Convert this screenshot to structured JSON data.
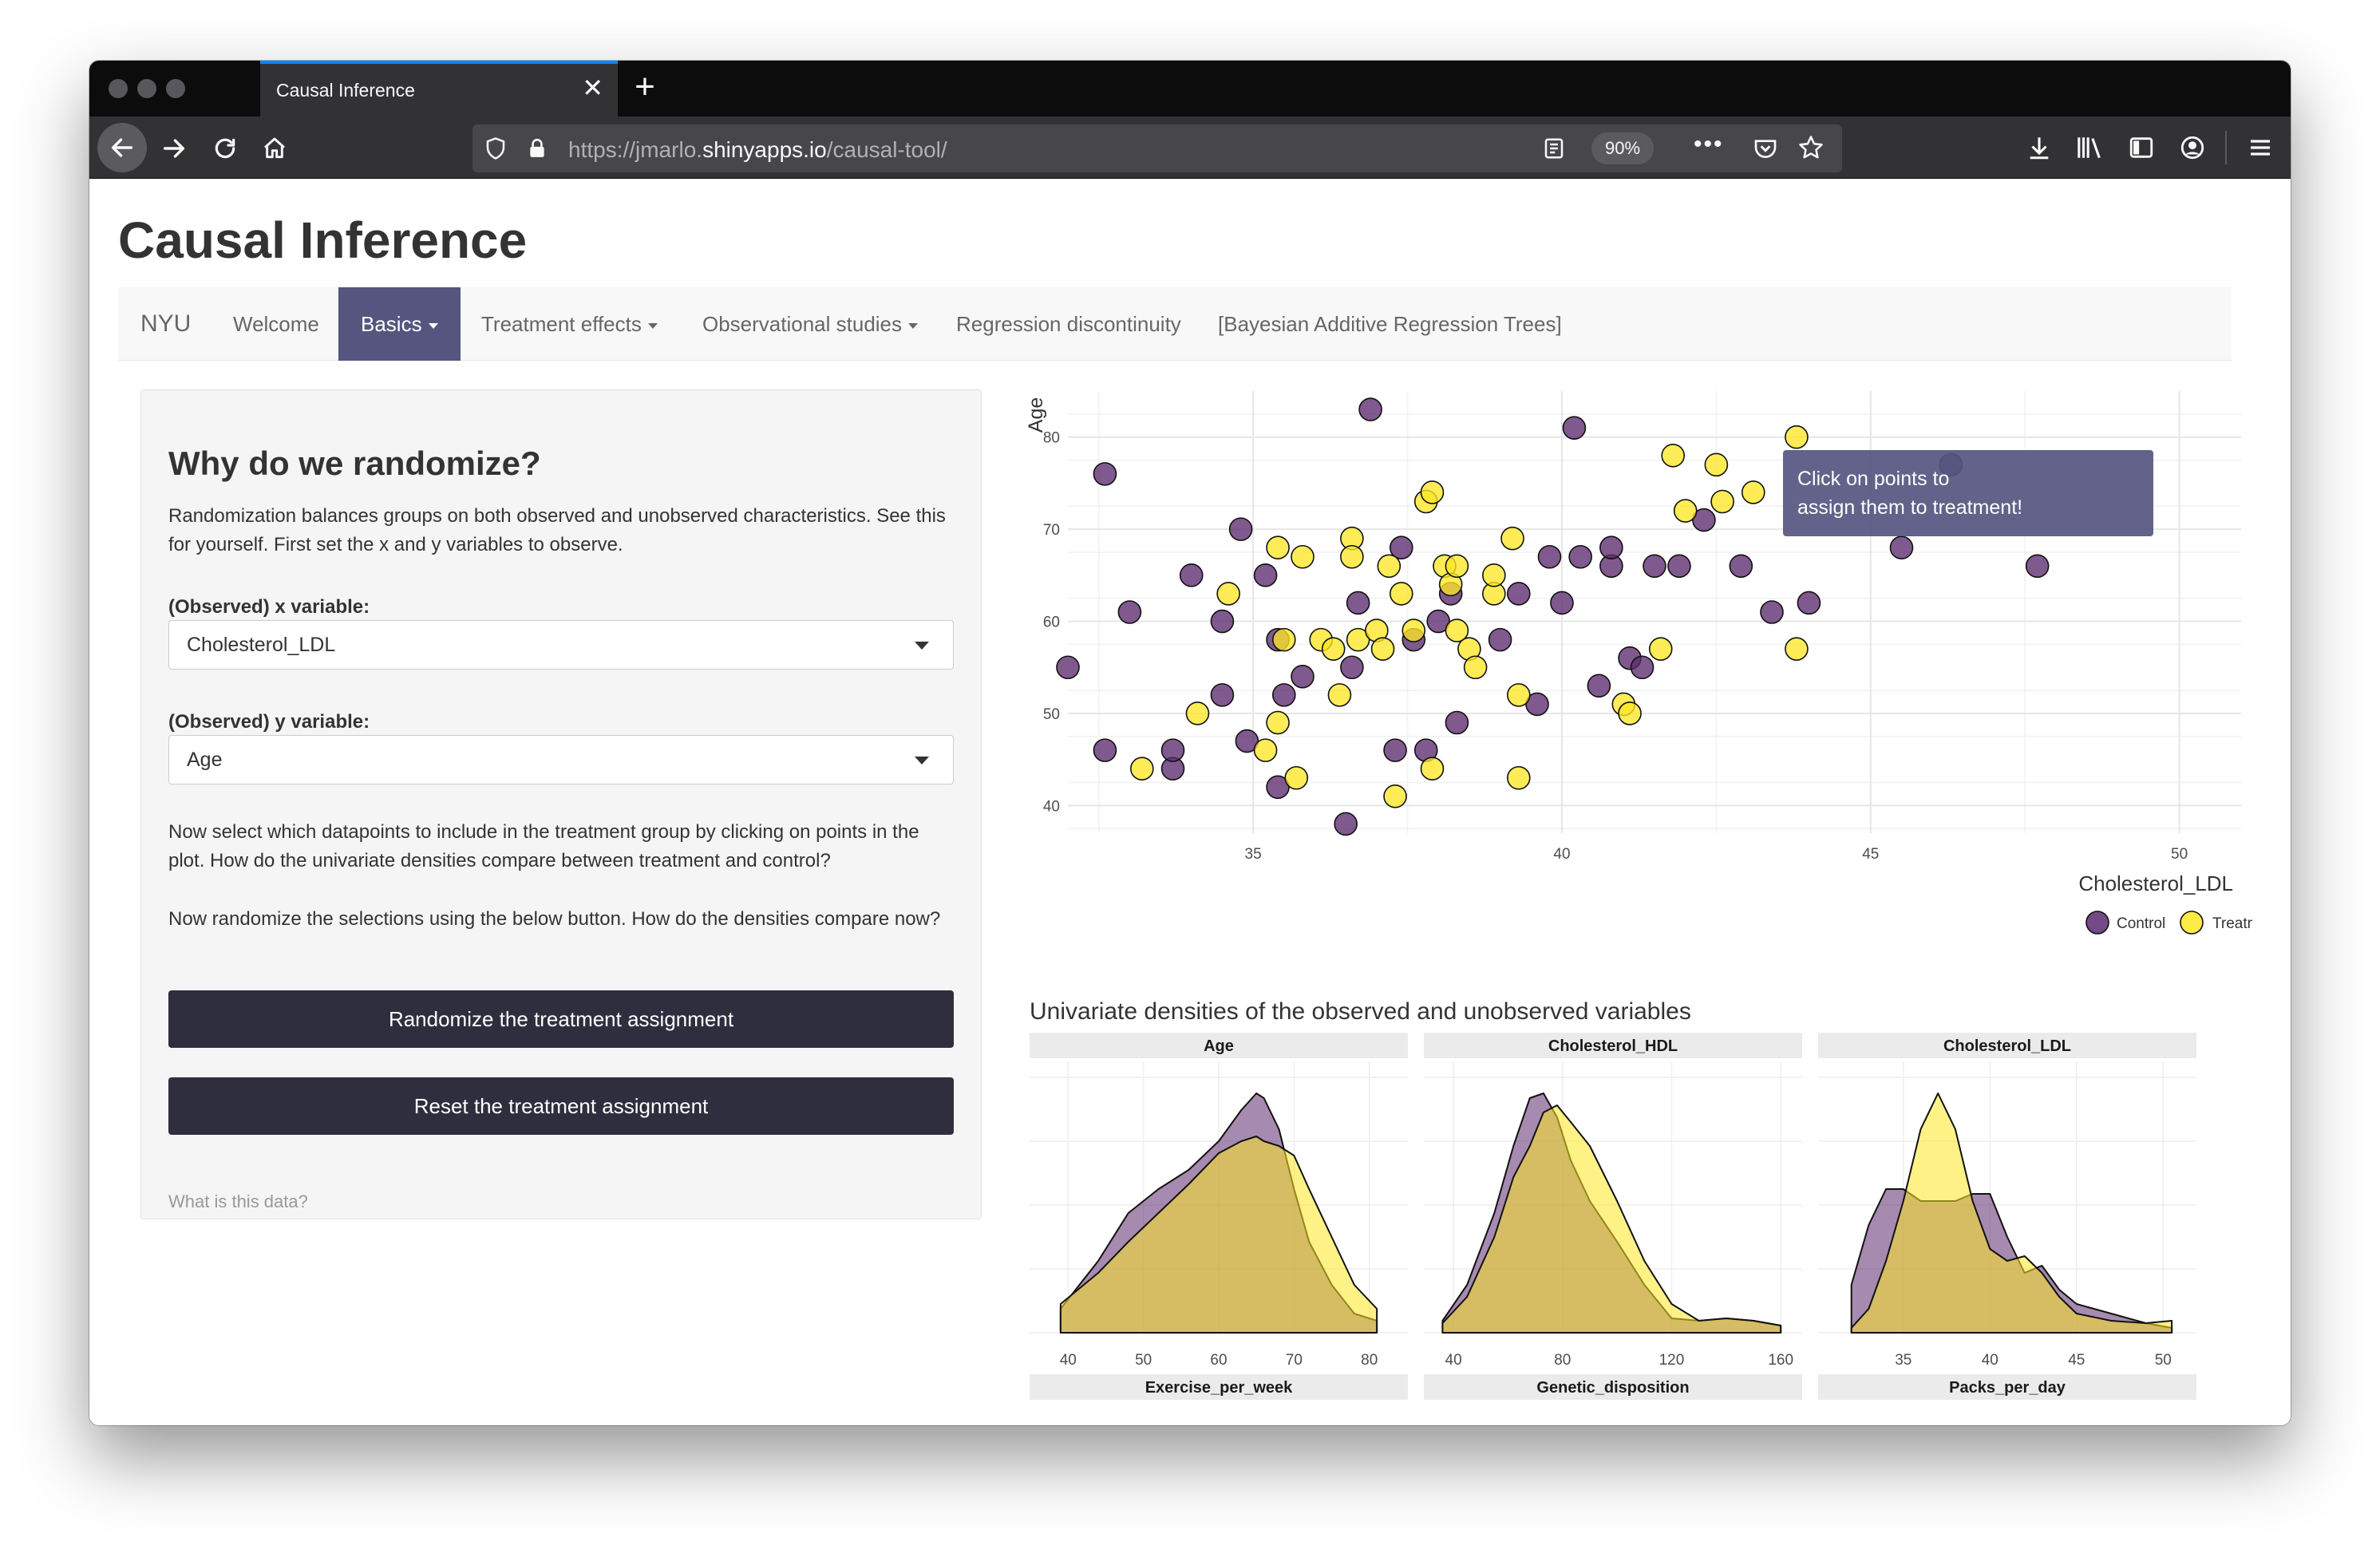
{
  "browser": {
    "tab_title": "Causal Inference",
    "url_host": "https://jmarlo.",
    "url_domain": "shinyapps.io",
    "url_path": "/causal-tool/",
    "zoom": "90%"
  },
  "app": {
    "title": "Causal Inference",
    "menu": [
      "NYU",
      "Welcome",
      "Basics",
      "Treatment effects",
      "Observational studies",
      "Regression discontinuity",
      "[Bayesian Additive Regression Trees]"
    ]
  },
  "sidebar": {
    "title": "Why do we randomize?",
    "intro": "Randomization balances groups on both observed and unobserved characteristics. See this for yourself. First set the x and y variables to observe.",
    "x_label": "(Observed) x variable:",
    "x_value": "Cholesterol_LDL",
    "y_label": "(Observed) y variable:",
    "y_value": "Age",
    "p1": "Now select which datapoints to include in the treatment group by clicking on points in the plot. How do the univariate densities compare between treatment and control?",
    "p2": "Now randomize the selections using the below button. How do the densities compare now?",
    "btn_randomize": "Randomize the treatment assignment",
    "btn_reset": "Reset the treatment assignment",
    "link": "What is this data?"
  },
  "tooltip": "Click on points to assign them to treatment!",
  "density_title": "Univariate densities of the observed and unobserved variables",
  "colors": {
    "control": "#5c2a6e",
    "treatment": "#fde725",
    "overlap": "#c8a951"
  },
  "chart_data": [
    {
      "type": "scatter",
      "xlabel": "Cholesterol_LDL",
      "ylabel": "Age",
      "xlim": [
        32,
        51
      ],
      "ylim": [
        37,
        85
      ],
      "xticks": [
        35,
        40,
        45,
        50
      ],
      "yticks": [
        40,
        50,
        60,
        70,
        80
      ],
      "legend": [
        "Control",
        "Treatment"
      ],
      "series": [
        {
          "name": "Control",
          "points": [
            [
              32.0,
              55
            ],
            [
              32.6,
              46
            ],
            [
              32.6,
              76
            ],
            [
              33.0,
              61
            ],
            [
              33.7,
              44
            ],
            [
              33.7,
              46
            ],
            [
              34.0,
              65
            ],
            [
              34.5,
              60
            ],
            [
              34.5,
              52
            ],
            [
              34.8,
              70
            ],
            [
              34.9,
              47
            ],
            [
              35.2,
              65
            ],
            [
              35.4,
              58
            ],
            [
              35.4,
              42
            ],
            [
              35.5,
              52
            ],
            [
              35.8,
              54
            ],
            [
              36.5,
              38
            ],
            [
              36.6,
              55
            ],
            [
              36.7,
              62
            ],
            [
              36.9,
              83
            ],
            [
              37.3,
              46
            ],
            [
              37.4,
              68
            ],
            [
              37.6,
              58
            ],
            [
              37.8,
              46
            ],
            [
              38.0,
              60
            ],
            [
              38.2,
              63
            ],
            [
              38.3,
              49
            ],
            [
              39.0,
              58
            ],
            [
              39.3,
              63
            ],
            [
              39.6,
              51
            ],
            [
              39.8,
              67
            ],
            [
              40.2,
              81
            ],
            [
              40.0,
              62
            ],
            [
              40.3,
              67
            ],
            [
              40.6,
              53
            ],
            [
              40.8,
              66
            ],
            [
              40.8,
              68
            ],
            [
              41.1,
              56
            ],
            [
              41.3,
              55
            ],
            [
              41.5,
              66
            ],
            [
              41.9,
              66
            ],
            [
              42.3,
              71
            ],
            [
              42.9,
              66
            ],
            [
              43.4,
              61
            ],
            [
              44.0,
              62
            ],
            [
              45.5,
              68
            ],
            [
              46.3,
              77
            ],
            [
              47.7,
              66
            ]
          ]
        },
        {
          "name": "Treatment",
          "points": [
            [
              33.2,
              44
            ],
            [
              34.1,
              50
            ],
            [
              34.6,
              63
            ],
            [
              35.2,
              46
            ],
            [
              35.4,
              68
            ],
            [
              35.4,
              49
            ],
            [
              35.5,
              58
            ],
            [
              35.7,
              43
            ],
            [
              35.8,
              67
            ],
            [
              36.1,
              58
            ],
            [
              36.3,
              57
            ],
            [
              36.4,
              52
            ],
            [
              36.6,
              69
            ],
            [
              36.6,
              67
            ],
            [
              36.7,
              58
            ],
            [
              37.0,
              59
            ],
            [
              37.1,
              57
            ],
            [
              37.2,
              66
            ],
            [
              37.4,
              63
            ],
            [
              37.3,
              41
            ],
            [
              37.6,
              59
            ],
            [
              37.8,
              73
            ],
            [
              37.9,
              74
            ],
            [
              37.9,
              44
            ],
            [
              38.1,
              66
            ],
            [
              38.2,
              64
            ],
            [
              38.3,
              59
            ],
            [
              38.3,
              66
            ],
            [
              38.5,
              57
            ],
            [
              38.6,
              55
            ],
            [
              38.9,
              63
            ],
            [
              38.9,
              65
            ],
            [
              39.2,
              69
            ],
            [
              39.3,
              52
            ],
            [
              39.3,
              43
            ],
            [
              41.0,
              51
            ],
            [
              41.1,
              50
            ],
            [
              41.6,
              57
            ],
            [
              41.8,
              78
            ],
            [
              42.0,
              72
            ],
            [
              42.5,
              77
            ],
            [
              42.6,
              73
            ],
            [
              43.1,
              74
            ],
            [
              43.8,
              80
            ],
            [
              43.8,
              57
            ]
          ]
        }
      ]
    },
    {
      "type": "area",
      "title": "Age",
      "xticks": [
        40,
        50,
        60,
        70,
        80
      ],
      "xlim": [
        37,
        83
      ],
      "series": [
        {
          "name": "Control",
          "x": [
            39,
            44,
            48,
            52,
            56,
            60,
            63,
            65,
            66,
            68,
            70,
            72,
            75,
            78,
            81
          ],
          "y": [
            0.1,
            0.3,
            0.5,
            0.6,
            0.68,
            0.8,
            0.93,
            1.0,
            0.98,
            0.85,
            0.6,
            0.38,
            0.2,
            0.08,
            0.05
          ]
        },
        {
          "name": "Treatment",
          "x": [
            39,
            44,
            48,
            52,
            56,
            60,
            63,
            65,
            66,
            68,
            70,
            72,
            75,
            78,
            81
          ],
          "y": [
            0.12,
            0.25,
            0.38,
            0.5,
            0.62,
            0.75,
            0.8,
            0.82,
            0.8,
            0.78,
            0.74,
            0.6,
            0.4,
            0.2,
            0.1
          ]
        }
      ]
    },
    {
      "type": "area",
      "title": "Cholesterol_HDL",
      "xticks": [
        40,
        80,
        120,
        160
      ],
      "xlim": [
        35,
        162
      ],
      "series": [
        {
          "name": "Control",
          "x": [
            36,
            45,
            55,
            62,
            68,
            73,
            78,
            83,
            90,
            100,
            110,
            120,
            130,
            140,
            150,
            160
          ],
          "y": [
            0.05,
            0.2,
            0.5,
            0.78,
            0.98,
            1.0,
            0.9,
            0.72,
            0.55,
            0.38,
            0.2,
            0.06,
            0.05,
            0.06,
            0.05,
            0.03
          ]
        },
        {
          "name": "Treatment",
          "x": [
            36,
            45,
            55,
            62,
            68,
            73,
            78,
            83,
            90,
            100,
            110,
            120,
            130,
            140,
            150,
            160
          ],
          "y": [
            0.04,
            0.15,
            0.4,
            0.65,
            0.78,
            0.92,
            0.95,
            0.88,
            0.78,
            0.55,
            0.3,
            0.12,
            0.05,
            0.06,
            0.05,
            0.03
          ]
        }
      ]
    },
    {
      "type": "area",
      "title": "Cholesterol_LDL",
      "xticks": [
        35,
        40,
        45,
        50
      ],
      "xlim": [
        31,
        51
      ],
      "series": [
        {
          "name": "Control",
          "x": [
            32,
            33,
            34,
            35,
            36,
            37,
            38,
            39,
            40,
            41,
            42,
            43,
            44,
            45,
            47,
            49,
            50.5
          ],
          "y": [
            0.2,
            0.45,
            0.6,
            0.6,
            0.55,
            0.55,
            0.55,
            0.58,
            0.58,
            0.4,
            0.25,
            0.28,
            0.18,
            0.12,
            0.08,
            0.04,
            0.02
          ]
        },
        {
          "name": "Treatment",
          "x": [
            32,
            33,
            34,
            35,
            36,
            37,
            38,
            39,
            40,
            41,
            42,
            43,
            44,
            45,
            47,
            49,
            50.5
          ],
          "y": [
            0.02,
            0.1,
            0.3,
            0.55,
            0.85,
            1.0,
            0.85,
            0.55,
            0.35,
            0.3,
            0.32,
            0.25,
            0.15,
            0.08,
            0.05,
            0.04,
            0.05
          ]
        }
      ]
    },
    {
      "type": "area",
      "title": "Exercise_per_week",
      "series": []
    },
    {
      "type": "area",
      "title": "Genetic_disposition",
      "series": []
    },
    {
      "type": "area",
      "title": "Packs_per_day",
      "series": []
    }
  ]
}
